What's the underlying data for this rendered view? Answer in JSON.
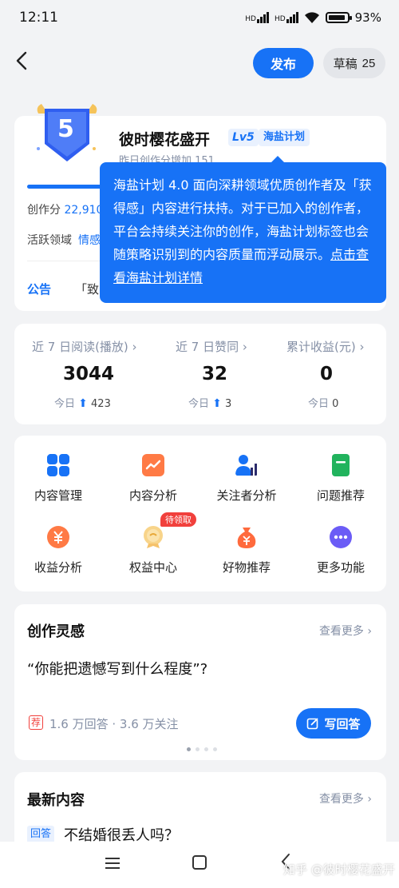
{
  "status": {
    "time": "12:11",
    "network_1": "HD",
    "network_2": "HD",
    "battery": "93"
  },
  "header": {
    "publish_label": "发布",
    "draft_label": "草稿",
    "draft_count": "25"
  },
  "profile": {
    "level_number": "5",
    "username": "彼时樱花盛开",
    "level_tag": "Lv5",
    "plan_tag": "海盐计划",
    "yesterday_text": "昨日创作分增加 151",
    "score_label": "创作分",
    "score_value": "22,910",
    "field_label": "活跃领域",
    "field_value": "情感",
    "notice_label": "公告",
    "notice_text": "「致"
  },
  "tooltip": {
    "text": "海盐计划 4.0 面向深耕领域优质创作者及「获得感」内容进行扶持。对于已加入的创作者，平台会持续关注你的创作，海盐计划标签也会随策略识别到的内容质量而浮动展示。",
    "link": "点击查看海盐计划详情"
  },
  "stats": [
    {
      "label": "近 7 日阅读(播放) ›",
      "value": "3044",
      "today_label": "今日",
      "today_arrow": "⬆",
      "today_value": "423"
    },
    {
      "label": "近 7 日赞同 ›",
      "value": "32",
      "today_label": "今日",
      "today_arrow": "⬆",
      "today_value": "3"
    },
    {
      "label": "累计收益(元) ›",
      "value": "0",
      "today_label": "今日",
      "today_arrow": "",
      "today_value": "0"
    }
  ],
  "tools": [
    {
      "label": "内容管理",
      "icon": "grid-icon",
      "color": "#1772f6"
    },
    {
      "label": "内容分析",
      "icon": "trend-chart-icon",
      "color": "#ff7a45"
    },
    {
      "label": "关注者分析",
      "icon": "followers-icon",
      "color": "#1772f6"
    },
    {
      "label": "问题推荐",
      "icon": "question-card-icon",
      "color": "#21b35d"
    },
    {
      "label": "收益分析",
      "icon": "yen-coin-icon",
      "color": "#ff7a45"
    },
    {
      "label": "权益中心",
      "icon": "medal-icon",
      "color": "#f5c26b"
    },
    {
      "label": "好物推荐",
      "icon": "money-bag-icon",
      "color": "#ff6a3d"
    },
    {
      "label": "更多功能",
      "icon": "more-dots-icon",
      "color": "#6b5cf6"
    }
  ],
  "pending_badge": "待领取",
  "inspiration": {
    "title": "创作灵感",
    "more": "查看更多 ›",
    "question": "“你能把遗憾写到什么程度”?",
    "rec_tag": "荐",
    "meta": "1.6 万回答 · 3.6 万关注",
    "answer_label": "写回答"
  },
  "latest": {
    "title": "最新内容",
    "more": "查看更多 ›",
    "tag": "回答",
    "item_title": "不结婚很丢人吗？"
  },
  "watermark": "知乎 @彼时樱花盛开"
}
